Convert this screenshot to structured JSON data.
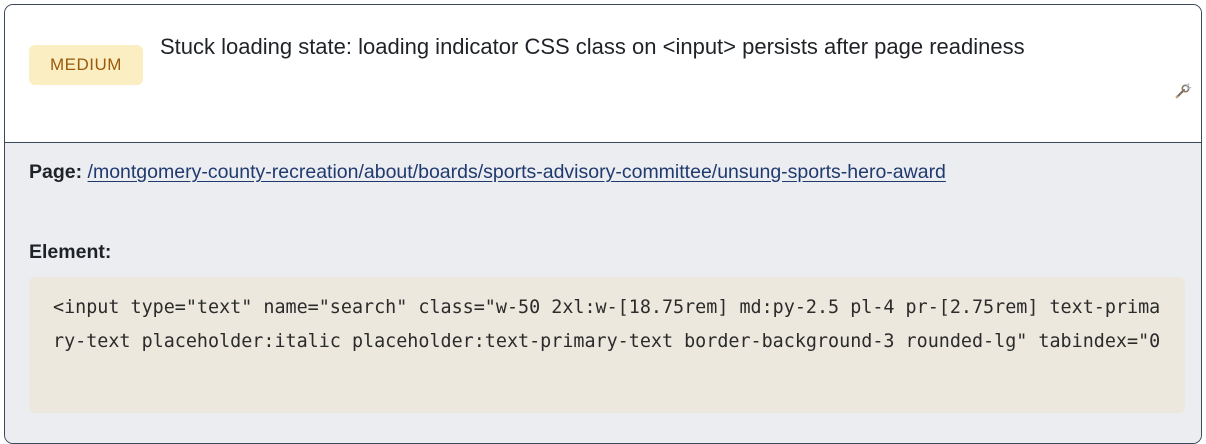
{
  "issue": {
    "severity": "MEDIUM",
    "title": "Stuck loading state: loading indicator CSS class on <input> persists after page readiness",
    "tool_icon": "wrench-tool-icon"
  },
  "details": {
    "page_label": "Page:",
    "page_url": "/montgomery-county-recreation/about/boards/sports-advisory-committee/unsung-sports-hero-award",
    "element_label": "Element:",
    "element_code": "<input type=\"text\" name=\"search\" class=\"w-50 2xl:w-[18.75rem] md:py-2.5 pl-4 pr-[2.75rem] text-primary-text placeholder:italic placeholder:text-primary-text border-background-3 rounded-lg\" tabindex=\"0"
  },
  "colors": {
    "badge_bg": "#fbeec2",
    "badge_text": "#9a5a0a",
    "border": "#3b4a5a",
    "body_bg": "#ecedf1",
    "code_bg": "#ece8dd",
    "link": "#1f3a6e"
  }
}
